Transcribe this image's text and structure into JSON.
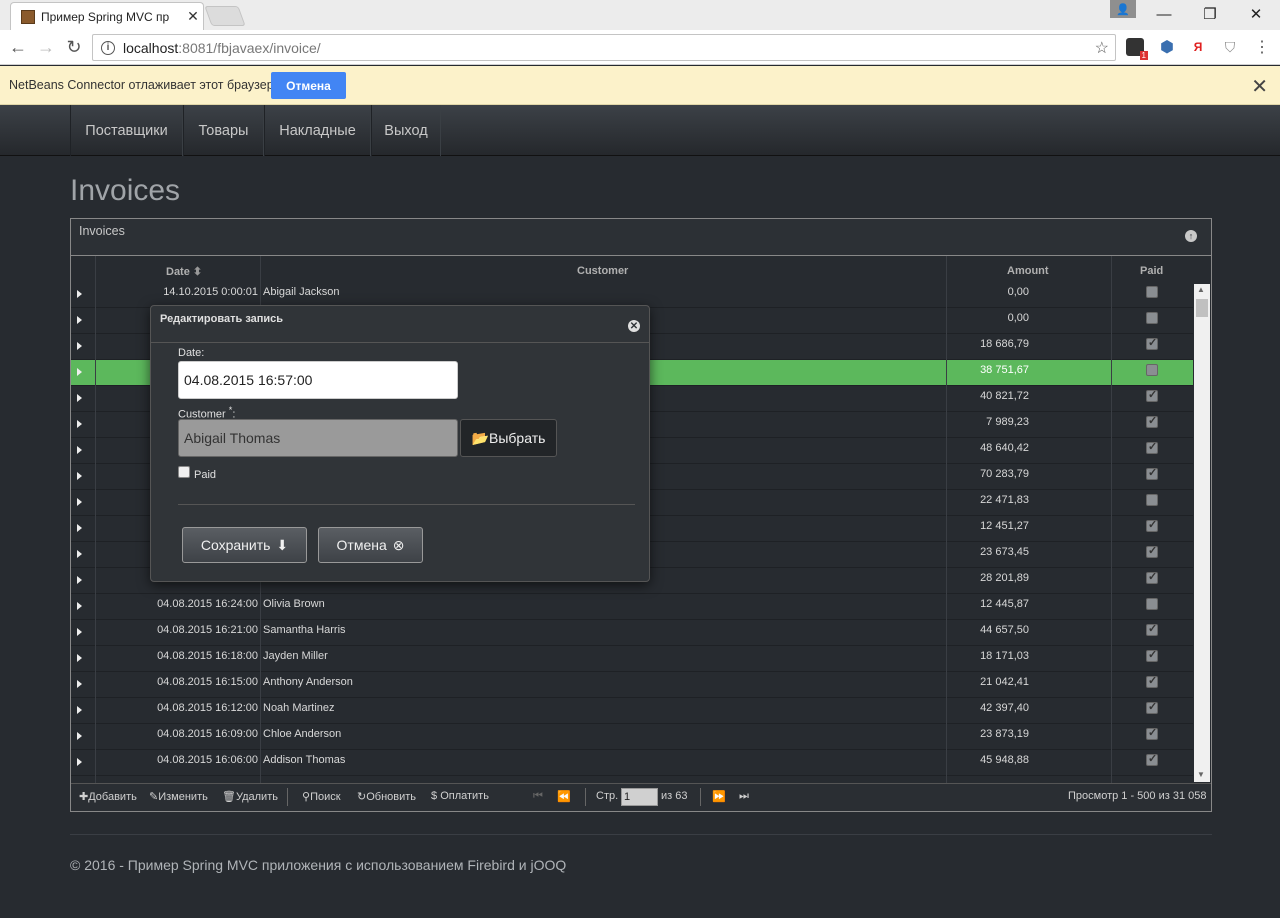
{
  "browser": {
    "tab_title": "Пример Spring MVC пр",
    "url_host": "localhost",
    "url_path": ":8081/fbjavaex/invoice/",
    "ext_badge": "1",
    "ext_y": "Я"
  },
  "infobar": {
    "text": "NetBeans Connector отлаживает этот браузер.",
    "cancel": "Отмена"
  },
  "nav": {
    "items": [
      "Поставщики",
      "Товары",
      "Накладные",
      "Выход"
    ]
  },
  "page": {
    "title": "Invoices"
  },
  "grid": {
    "caption": "Invoices",
    "headers": {
      "date": "Date",
      "customer": "Customer",
      "amount": "Amount",
      "paid": "Paid"
    },
    "rows": [
      {
        "date": "14.10.2015 0:00:01",
        "customer": "Abigail Jackson",
        "amount": "0,00",
        "paid": false
      },
      {
        "date": "",
        "customer": "",
        "amount": "0,00",
        "paid": false
      },
      {
        "date": "",
        "customer": "",
        "amount": "18 686,79",
        "paid": true
      },
      {
        "date": "",
        "customer": "",
        "amount": "38 751,67",
        "paid": false,
        "selected": true
      },
      {
        "date": "",
        "customer": "",
        "amount": "40 821,72",
        "paid": true
      },
      {
        "date": "",
        "customer": "",
        "amount": "7 989,23",
        "paid": true
      },
      {
        "date": "",
        "customer": "",
        "amount": "48 640,42",
        "paid": true
      },
      {
        "date": "",
        "customer": "",
        "amount": "70 283,79",
        "paid": true
      },
      {
        "date": "",
        "customer": "",
        "amount": "22 471,83",
        "paid": false
      },
      {
        "date": "",
        "customer": "",
        "amount": "12 451,27",
        "paid": true
      },
      {
        "date": "",
        "customer": "",
        "amount": "23 673,45",
        "paid": true
      },
      {
        "date": "",
        "customer": "",
        "amount": "28 201,89",
        "paid": true
      },
      {
        "date": "04.08.2015 16:24:00",
        "customer": "Olivia Brown",
        "amount": "12 445,87",
        "paid": false
      },
      {
        "date": "04.08.2015 16:21:00",
        "customer": "Samantha Harris",
        "amount": "44 657,50",
        "paid": true
      },
      {
        "date": "04.08.2015 16:18:00",
        "customer": "Jayden Miller",
        "amount": "18 171,03",
        "paid": true
      },
      {
        "date": "04.08.2015 16:15:00",
        "customer": "Anthony Anderson",
        "amount": "21 042,41",
        "paid": true
      },
      {
        "date": "04.08.2015 16:12:00",
        "customer": "Noah Martinez",
        "amount": "42 397,40",
        "paid": true
      },
      {
        "date": "04.08.2015 16:09:00",
        "customer": "Chloe Anderson",
        "amount": "23 873,19",
        "paid": true
      },
      {
        "date": "04.08.2015 16:06:00",
        "customer": "Addison Thomas",
        "amount": "45 948,88",
        "paid": true
      }
    ]
  },
  "pager": {
    "add": "Добавить",
    "edit": "Изменить",
    "delete": "Удалить",
    "search": "Поиск",
    "refresh": "Обновить",
    "pay": "Оплатить",
    "page_label": "Стр.",
    "page_value": "1",
    "of_pages": "из 63",
    "view_info": "Просмотр 1 - 500 из 31 058"
  },
  "modal": {
    "title": "Редактировать запись",
    "date_label": "Date:",
    "date_value": "04.08.2015 16:57:00",
    "customer_label": "Customer",
    "customer_required": "*",
    "customer_label_colon": ":",
    "customer_value": "Abigail Thomas",
    "choose": "Выбрать",
    "paid_label": "Paid",
    "save": "Сохранить",
    "cancel": "Отмена"
  },
  "footer": {
    "text": "© 2016 - Пример Spring MVC приложения с использованием Firebird и jOOQ"
  }
}
